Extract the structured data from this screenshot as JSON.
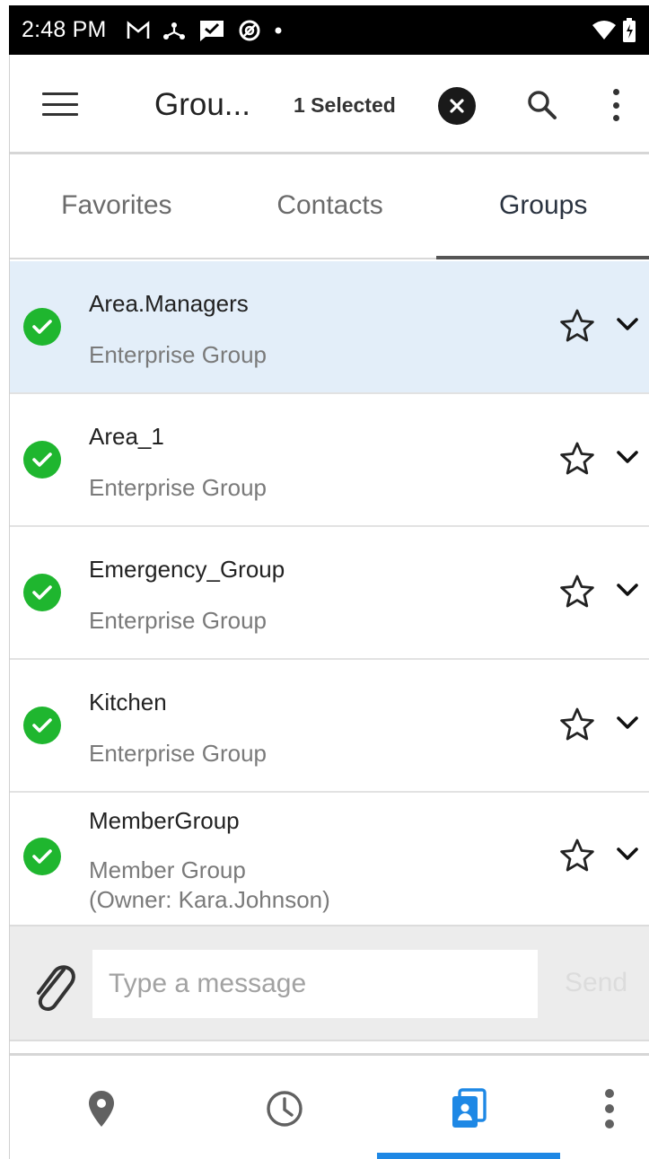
{
  "status_bar": {
    "time": "2:48 PM",
    "icons": [
      "gmail-icon",
      "network-icon",
      "message-check-icon",
      "vpn-icon",
      "dot-icon"
    ],
    "right_icons": [
      "wifi-icon",
      "battery-icon"
    ]
  },
  "toolbar": {
    "title": "Grou...",
    "selected_count": "1 Selected"
  },
  "tabs": [
    {
      "label": "Favorites",
      "active": false
    },
    {
      "label": "Contacts",
      "active": false
    },
    {
      "label": "Groups",
      "active": true
    }
  ],
  "groups": [
    {
      "name": "Area.Managers",
      "type": "Enterprise Group",
      "type2": "",
      "selected": true
    },
    {
      "name": "Area_1",
      "type": "Enterprise Group",
      "type2": "",
      "selected": false
    },
    {
      "name": "Emergency_Group",
      "type": "Enterprise Group",
      "type2": "",
      "selected": false
    },
    {
      "name": "Kitchen",
      "type": "Enterprise Group",
      "type2": "",
      "selected": false
    },
    {
      "name": "MemberGroup",
      "type": "Member Group",
      "type2": "(Owner: Kara.Johnson)",
      "selected": false
    }
  ],
  "composer": {
    "placeholder": "Type a message",
    "send_label": "Send"
  },
  "bottom_nav": {
    "items": [
      "location-icon",
      "history-icon",
      "contacts-icon",
      "more-icon"
    ],
    "active_index": 2
  },
  "colors": {
    "accent": "#1e88e5",
    "check_green": "#1fb62f",
    "selected_row": "#e3eef9"
  }
}
